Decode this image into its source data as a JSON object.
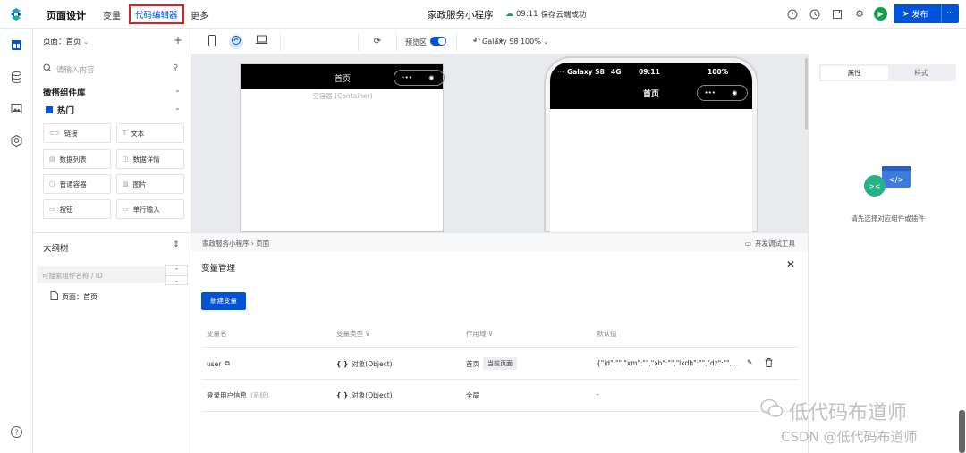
{
  "header": {
    "page_design": "页面设计",
    "variables": "变量",
    "code_editor": "代码编辑器",
    "more": "更多",
    "app_title": "家政服务小程序",
    "save_time": "09:11",
    "save_status": "保存云端成功",
    "publish": "发布",
    "publish_more": "···"
  },
  "left_panel": {
    "page_label": "页面：首页",
    "plus": "+",
    "search_placeholder": "请输入内容",
    "library_title": "微搭组件库",
    "hot_title": "热门",
    "components": [
      "链接",
      "文本",
      "数据列表",
      "数据详情",
      "普通容器",
      "图片",
      "按钮",
      "单行输入"
    ]
  },
  "outline": {
    "title": "大纲树",
    "search_placeholder": "可搜索组件名称 / ID",
    "node": "页面：首页"
  },
  "toolbar": {
    "device": "Galaxy S8 100%",
    "preview": "预览区"
  },
  "canvas": {
    "page_title": "首页",
    "container_label": "空容器 (Container)",
    "capsule_more": "•••",
    "phone_device": "Galaxy S8",
    "phone_network": "4G",
    "phone_time": "09:11",
    "phone_battery": "100%",
    "phone_title": "首页"
  },
  "breadcrumb": {
    "path": "家政服务小程序  ›  页面",
    "dev_tools": "开发调试工具"
  },
  "variable_manager": {
    "title": "变量管理",
    "close": "✕",
    "new_button": "新建变量",
    "columns": [
      "变量名",
      "变量类型",
      "作用域",
      "默认值"
    ],
    "rows": [
      {
        "name": "user",
        "type": "对象(Object)",
        "scope": "首页",
        "scope_tag": "当前页面",
        "default": "{\"id\":\"\",\"xm\":\"\",\"xb\":\"\",\"lxdh\":\"\",\"dz\":\"\",..."
      },
      {
        "name": "登录用户信息",
        "system": "(系统)",
        "type": "对象(Object)",
        "scope": "全局",
        "scope_tag": "",
        "default": "-"
      }
    ]
  },
  "right_panel": {
    "tab_props": "属性",
    "tab_style": "样式",
    "hint": "请先选择对应组件或插件"
  },
  "watermark": {
    "line1": "低代码布道师",
    "line2": "CSDN @低代码布道师"
  },
  "colors": {
    "primary": "#0052d9",
    "run": "#12a34a",
    "highlight": "#e02020"
  }
}
